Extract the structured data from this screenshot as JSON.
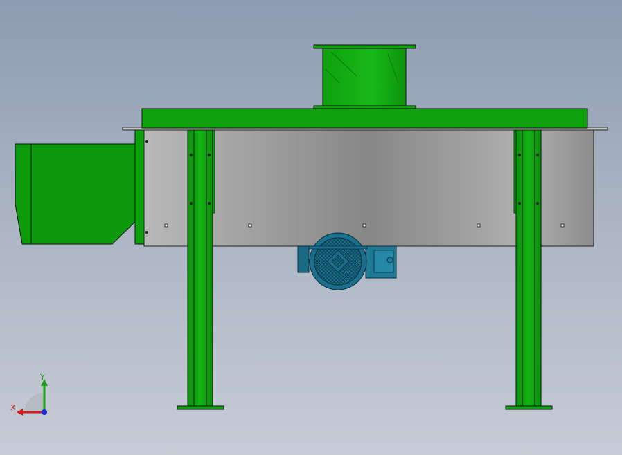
{
  "viewport": {
    "background_top": "#8d9cb2",
    "background_bottom": "#c6ccd6"
  },
  "model": {
    "view": "front",
    "color_frame": "#0ea10e",
    "color_frame_dark": "#087d08",
    "color_housing": "#a3a3a3",
    "color_motor": "#1b6e8c",
    "color_outline": "#111111"
  },
  "triad": {
    "x_label": "X",
    "y_label": "Y",
    "x_color": "#d11a1a",
    "y_color": "#16a316",
    "z_color": "#1a2bd1"
  }
}
